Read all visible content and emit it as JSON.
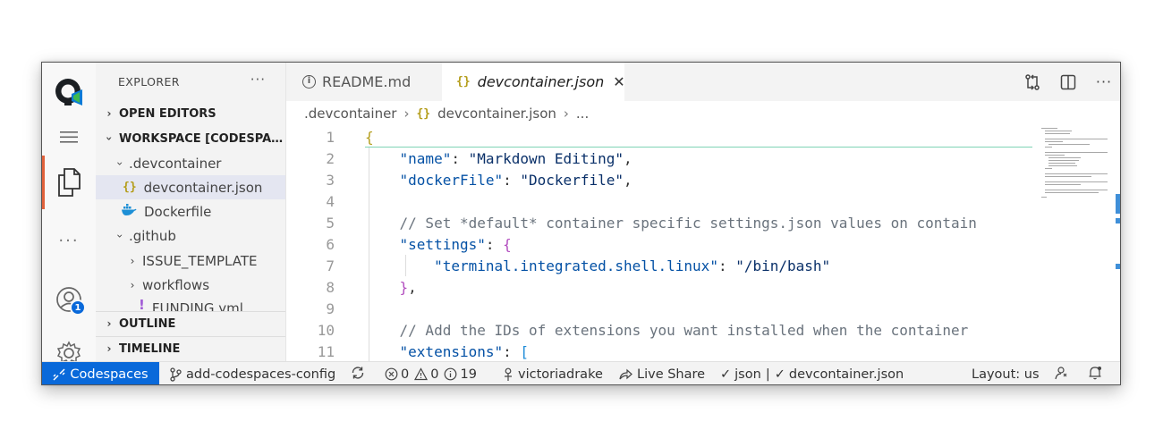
{
  "sidebar": {
    "title": "EXPLORER",
    "more": "···",
    "sections": {
      "open_editors": "OPEN EDITORS",
      "workspace": "WORKSPACE [CODESPACES]",
      "outline": "OUTLINE",
      "timeline": "TIMELINE"
    },
    "tree": [
      {
        "label": ".devcontainer",
        "type": "folder",
        "expanded": true
      },
      {
        "label": "devcontainer.json",
        "type": "json",
        "selected": true
      },
      {
        "label": "Dockerfile",
        "type": "docker"
      },
      {
        "label": ".github",
        "type": "folder",
        "expanded": true
      },
      {
        "label": "ISSUE_TEMPLATE",
        "type": "folder",
        "expanded": false
      },
      {
        "label": "workflows",
        "type": "folder",
        "expanded": false
      },
      {
        "label": "FUNDING.yml",
        "type": "yaml"
      }
    ]
  },
  "activity": {
    "accounts_badge": "1"
  },
  "tabs": [
    {
      "label": "README.md",
      "icon": "info-icon",
      "active": false
    },
    {
      "label": "devcontainer.json",
      "icon": "braces-icon",
      "active": true,
      "close": "✕"
    }
  ],
  "breadcrumb": {
    "folder": ".devcontainer",
    "file": "devcontainer.json",
    "ellipsis": "..."
  },
  "editor": {
    "line_numbers": [
      "1",
      "2",
      "3",
      "4",
      "5",
      "6",
      "7",
      "8",
      "9",
      "10",
      "11"
    ],
    "code": {
      "l1_open": "{",
      "l2_key": "\"name\"",
      "l2_val": "\"Markdown Editing\"",
      "l3_key": "\"dockerFile\"",
      "l3_val": "\"Dockerfile\"",
      "l5_comment": "// Set *default* container specific settings.json values on contain",
      "l6_key": "\"settings\"",
      "l6_open": "{",
      "l7_key": "\"terminal.integrated.shell.linux\"",
      "l7_val": "\"/bin/bash\"",
      "l8_close": "}",
      "l10_comment": "// Add the IDs of extensions you want installed when the container",
      "l11_key": "\"extensions\"",
      "l11_open": "["
    }
  },
  "statusbar": {
    "remote": "Codespaces",
    "branch": "add-codespaces-config",
    "errors": "0",
    "warnings": "0",
    "info": "19",
    "user": "victoriadrake",
    "live_share": "Live Share",
    "lang_json": "json",
    "separator": "|",
    "schema": "devcontainer.json",
    "layout": "Layout: us"
  },
  "colors": {
    "accent": "#0969da",
    "active_activity": "#e0603a"
  }
}
